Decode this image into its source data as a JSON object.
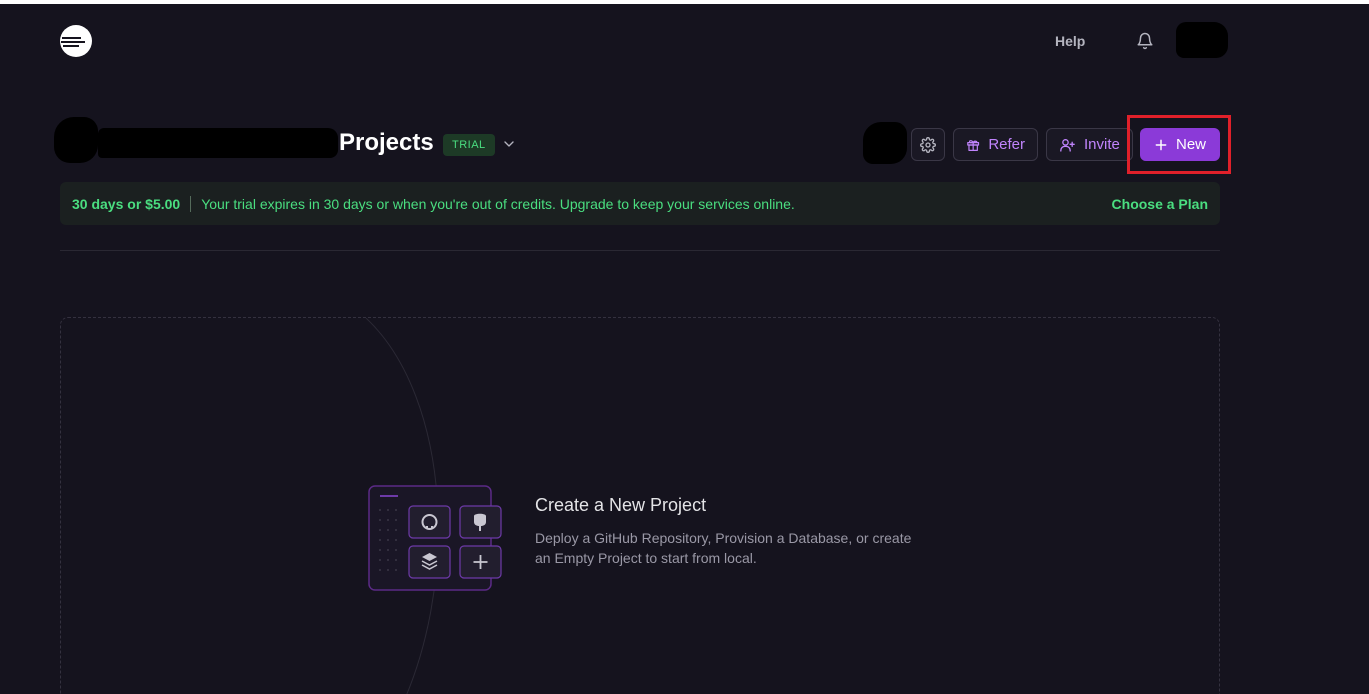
{
  "header": {
    "help_label": "Help"
  },
  "projects": {
    "title": "Projects",
    "badge": "TRIAL"
  },
  "actions": {
    "refer_label": "Refer",
    "invite_label": "Invite",
    "new_label": "New"
  },
  "banner": {
    "credits": "30 days or $5.00",
    "message": "Your trial expires in 30 days or when you're out of credits. Upgrade to keep your services online.",
    "cta": "Choose a Plan"
  },
  "empty_state": {
    "title": "Create a New Project",
    "description": "Deploy a GitHub Repository, Provision a Database, or create an Empty Project to start from local."
  },
  "icons": [
    "logo-icon",
    "bell-icon",
    "chevron-down-icon",
    "gear-icon",
    "gift-icon",
    "user-plus-icon",
    "plus-icon",
    "github-icon",
    "postgres-icon",
    "layers-icon"
  ],
  "colors": {
    "background": "#15131e",
    "accent": "#8b3ad8",
    "accent_text": "#c084fc",
    "success": "#4ade80",
    "highlight": "#e0202a"
  }
}
